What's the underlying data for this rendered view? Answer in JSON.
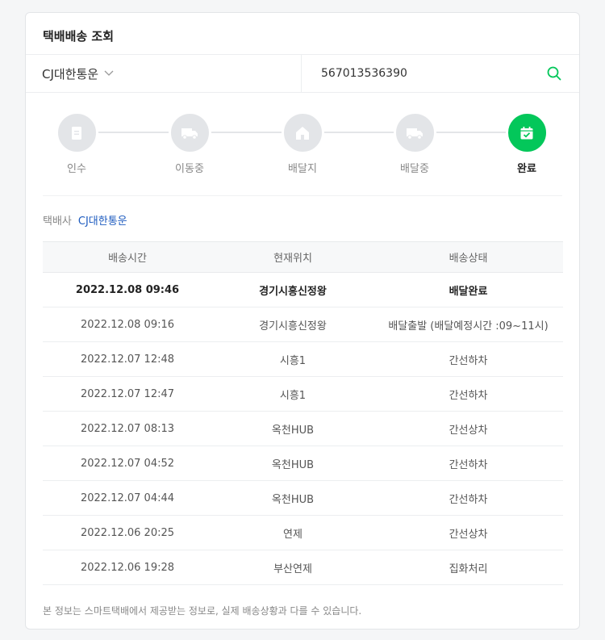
{
  "header": {
    "title": "택배배송 조회"
  },
  "search": {
    "carrier": "CJ대한통운",
    "invoice_number": "567013536390"
  },
  "steps": [
    {
      "label": "인수",
      "icon": "receipt-icon",
      "active": false
    },
    {
      "label": "이동중",
      "icon": "truck-icon",
      "active": false
    },
    {
      "label": "배달지",
      "icon": "home-icon",
      "active": false
    },
    {
      "label": "배달중",
      "icon": "truck-icon",
      "active": false
    },
    {
      "label": "완료",
      "icon": "calendar-check-icon",
      "active": true
    }
  ],
  "carrier_info": {
    "key": "택배사",
    "value": "CJ대한통운"
  },
  "table": {
    "headers": [
      "배송시간",
      "현재위치",
      "배송상태"
    ],
    "rows": [
      [
        "2022.12.08 09:46",
        "경기시흥신정왕",
        "배달완료"
      ],
      [
        "2022.12.08 09:16",
        "경기시흥신정왕",
        "배달출발 (배달예정시간 :09~11시)"
      ],
      [
        "2022.12.07 12:48",
        "시흥1",
        "간선하차"
      ],
      [
        "2022.12.07 12:47",
        "시흥1",
        "간선하차"
      ],
      [
        "2022.12.07 08:13",
        "옥천HUB",
        "간선상차"
      ],
      [
        "2022.12.07 04:52",
        "옥천HUB",
        "간선하차"
      ],
      [
        "2022.12.07 04:44",
        "옥천HUB",
        "간선하차"
      ],
      [
        "2022.12.06 20:25",
        "연제",
        "간선상차"
      ],
      [
        "2022.12.06 19:28",
        "부산연제",
        "집화처리"
      ]
    ]
  },
  "note": "본 정보는 스마트택배에서 제공받는 정보로, 실제 배송상황과 다를 수 있습니다.",
  "colors": {
    "accent": "#03c75a",
    "link": "#1d5bbf",
    "inactive": "#e3e5e8"
  }
}
